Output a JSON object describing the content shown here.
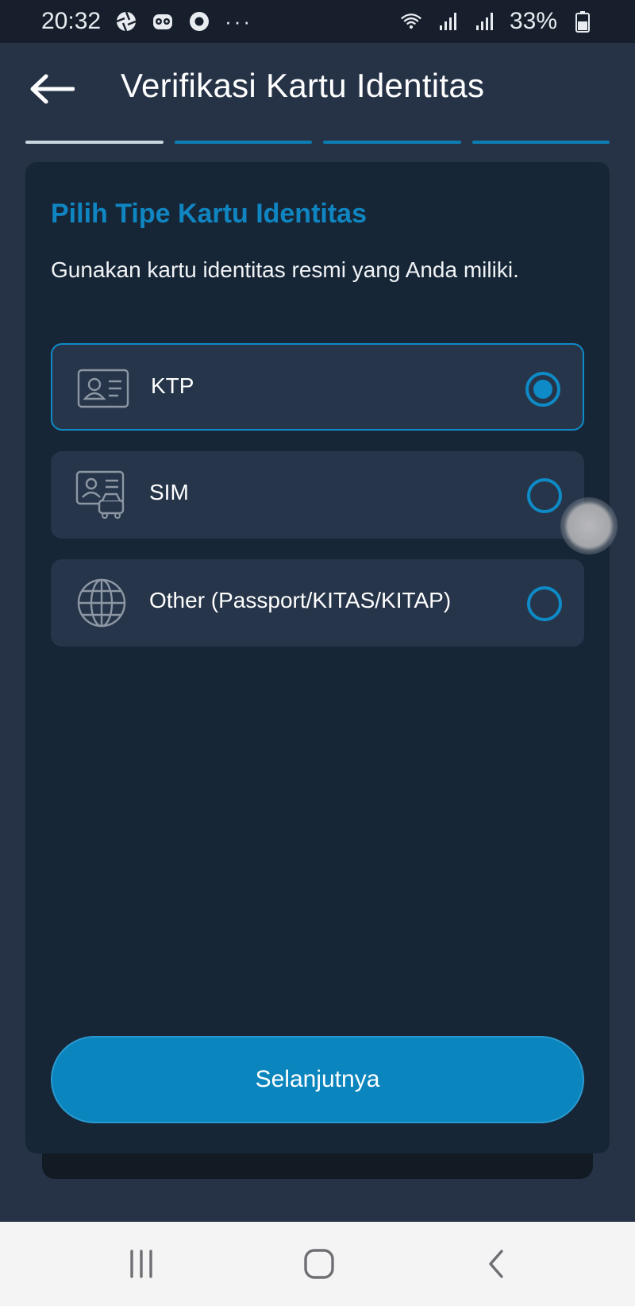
{
  "status_bar": {
    "time": "20:32",
    "battery": "33%",
    "more": "···",
    "icons": [
      "aperture-icon",
      "tripadvisor-icon",
      "location-pin-icon",
      "wifi-icon",
      "signal-icon",
      "signal-icon",
      "battery-icon"
    ]
  },
  "header": {
    "title": "Verifikasi Kartu Identitas",
    "back_icon": "arrow-left-icon"
  },
  "progress": {
    "total_steps": 4,
    "current_step": 1
  },
  "card": {
    "title": "Pilih Tipe Kartu Identitas",
    "description": "Gunakan kartu identitas resmi yang Anda miliki.",
    "options": [
      {
        "label": "KTP",
        "icon": "id-card-icon",
        "selected": true
      },
      {
        "label": "SIM",
        "icon": "driver-license-icon",
        "selected": false
      },
      {
        "label": "Other (Passport/KITAS/KITAP)",
        "icon": "globe-icon",
        "selected": false
      }
    ],
    "next_label": "Selanjutnya"
  },
  "nav_bar": {
    "items": [
      "recent-apps-icon",
      "home-icon",
      "back-icon"
    ]
  },
  "colors": {
    "accent": "#0e8ac6",
    "title_accent": "#0f86c2",
    "background": "#263347",
    "card": "#172636",
    "option": "#26354a"
  }
}
